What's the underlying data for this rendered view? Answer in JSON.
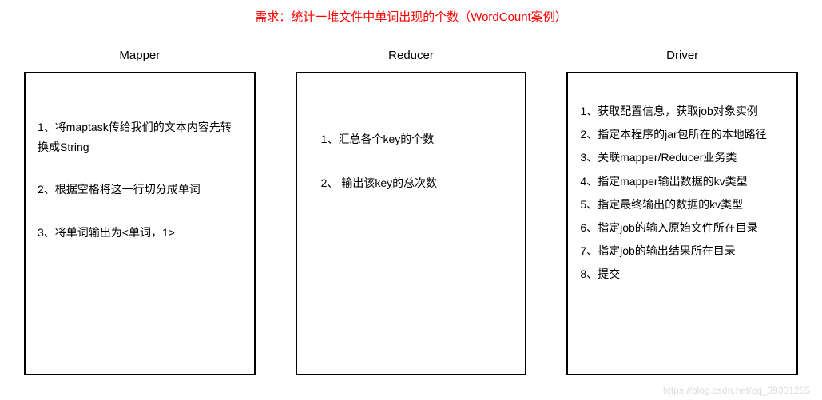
{
  "title": "需求：统计一堆文件中单词出现的个数（WordCount案例）",
  "columns": {
    "mapper": {
      "header": "Mapper",
      "items": [
        "1、将maptask传给我们的文本内容先转换成String",
        "2、根据空格将这一行切分成单词",
        "3、将单词输出为<单词，1>"
      ]
    },
    "reducer": {
      "header": "Reducer",
      "items": [
        "1、汇总各个key的个数",
        "2、 输出该key的总次数"
      ]
    },
    "driver": {
      "header": "Driver",
      "items": [
        "1、获取配置信息，获取job对象实例",
        "2、指定本程序的jar包所在的本地路径",
        "3、关联mapper/Reducer业务类",
        "4、指定mapper输出数据的kv类型",
        "5、指定最终输出的数据的kv类型",
        "6、指定job的输入原始文件所在目录",
        "7、指定job的输出结果所在目录",
        "8、提交"
      ]
    }
  },
  "watermark": "https://blog.csdn.net/qq_39331255"
}
